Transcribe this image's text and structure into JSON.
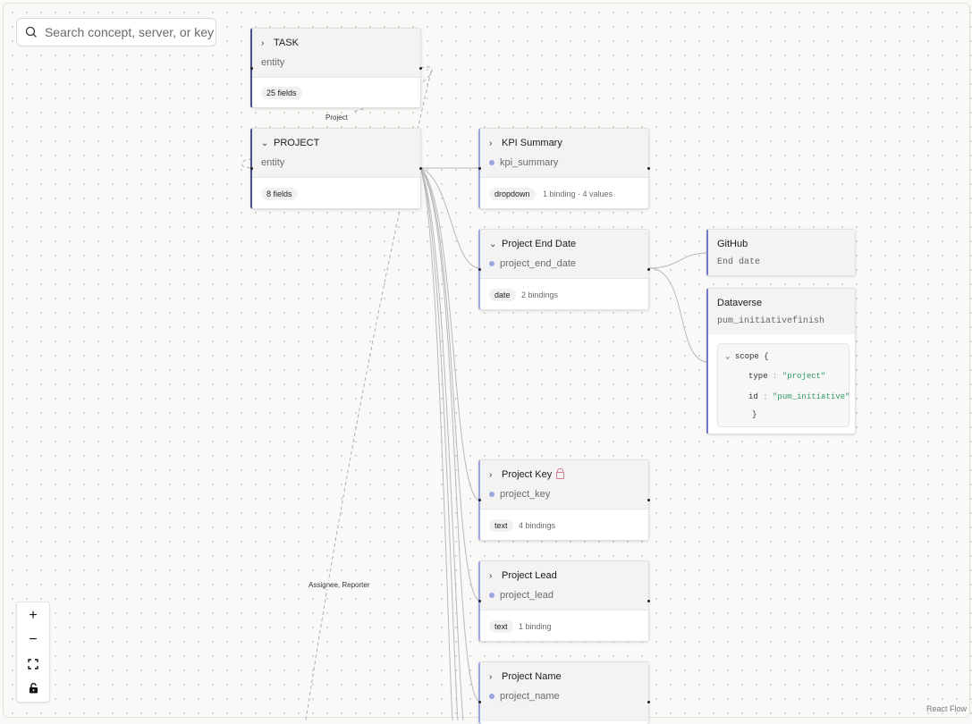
{
  "search": {
    "placeholder": "Search concept, server, or key"
  },
  "edges": {
    "task_project": "Project",
    "assignee_reporter": "Assignee, Reporter"
  },
  "entities": [
    {
      "title": "TASK",
      "kind": "entity",
      "fields": "25 fields",
      "expanded": false
    },
    {
      "title": "PROJECT",
      "kind": "entity",
      "fields": "8 fields",
      "expanded": true
    }
  ],
  "fields": [
    {
      "title": "KPI Summary",
      "key": "kpi_summary",
      "type": "dropdown",
      "meta": "1 binding · 4 values",
      "expanded": false,
      "locked": false
    },
    {
      "title": "Project End Date",
      "key": "project_end_date",
      "type": "date",
      "meta": "2 bindings",
      "expanded": true,
      "locked": false
    },
    {
      "title": "Project Key",
      "key": "project_key",
      "type": "text",
      "meta": "4 bindings",
      "expanded": false,
      "locked": true
    },
    {
      "title": "Project Lead",
      "key": "project_lead",
      "type": "text",
      "meta": "1 binding",
      "expanded": false,
      "locked": false
    },
    {
      "title": "Project Name",
      "key": "project_name",
      "type": "",
      "meta": "",
      "expanded": false,
      "locked": false
    }
  ],
  "sources": {
    "github": {
      "title": "GitHub",
      "key": "End date"
    },
    "dataverse": {
      "title": "Dataverse",
      "key": "pum_initiativefinish",
      "scope_label": "scope {",
      "lines": [
        {
          "k": "type",
          "v": "\"project\""
        },
        {
          "k": "id",
          "v": "\"pum_initiative\""
        }
      ],
      "close": "}"
    }
  },
  "controls": {
    "zoom_in": "+",
    "zoom_out": "−"
  },
  "attribution": "React Flow",
  "colors": {
    "accent_entity": "#4a4f8a",
    "accent_field": "#9aa6e2",
    "string_green": "#2e9d5e",
    "lock_red": "#d47a8a"
  }
}
